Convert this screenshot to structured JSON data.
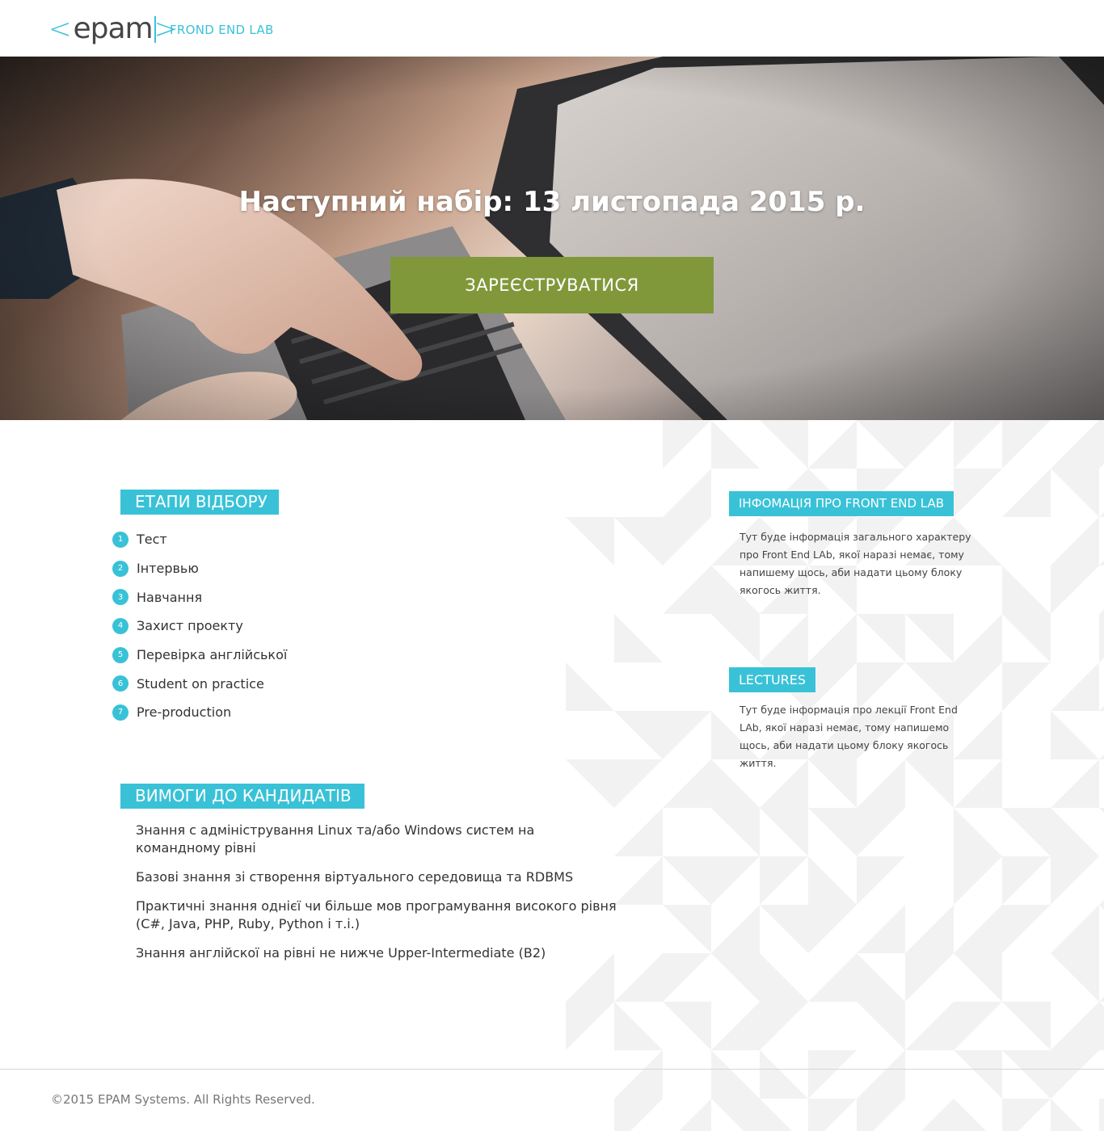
{
  "header": {
    "logo_text": "epam",
    "logo_left": "<",
    "logo_right": ">",
    "lab_name": "FROND END LAB"
  },
  "hero": {
    "title": "Наступний набір: 13 листопада 2015 р.",
    "register_label": "ЗАРЕЄСТРУВАТИСЯ"
  },
  "stages": {
    "heading": "ЕТАПИ ВІДБОРУ",
    "items": [
      {
        "num": "1",
        "label": "Тест"
      },
      {
        "num": "2",
        "label": "Інтервью"
      },
      {
        "num": "3",
        "label": "Навчання"
      },
      {
        "num": "4",
        "label": "Захист проекту"
      },
      {
        "num": "5",
        "label": "Перевірка англійської"
      },
      {
        "num": "6",
        "label": "Student on practice"
      },
      {
        "num": "7",
        "label": "Pre-production"
      }
    ]
  },
  "requirements": {
    "heading": "ВИМОГИ ДО КАНДИДАТІВ",
    "items": [
      "Знання с адміністрування Linux та/або Windows систем на командному рівні",
      "Базові знання зі створення віртуального середовища та RDBMS",
      "Практичні знання однієї чи більше мов програмування високого рівня (C#, Java, PHP, Ruby, Python і т.і.)",
      "Знання англійскої на рівні не нижче Upper-Intermediate (B2)"
    ]
  },
  "info": {
    "heading": "ІНФОМАЦІЯ ПРО FRONT END LAB",
    "text": "Тут буде інформація загального характеру про Front End LAb, якої наразі немає, тому напишему щось, аби надати цьому блоку якогось життя."
  },
  "lectures": {
    "heading": "LECTURES",
    "text": "Тут буде інформація про лекції Front End LAb, якої наразі немає, тому напишемо щось, аби надати цьому блоку якогось життя."
  },
  "footer": {
    "copyright": "©2015 EPAM Systems. All Rights Reserved."
  },
  "colors": {
    "accent": "#39c2d7",
    "button": "#80983a",
    "logo_text": "#464547",
    "pattern": "#f2f2f2"
  },
  "icons": {
    "logo": "epam-logo",
    "hero_image": "laptop-typing-photo"
  }
}
